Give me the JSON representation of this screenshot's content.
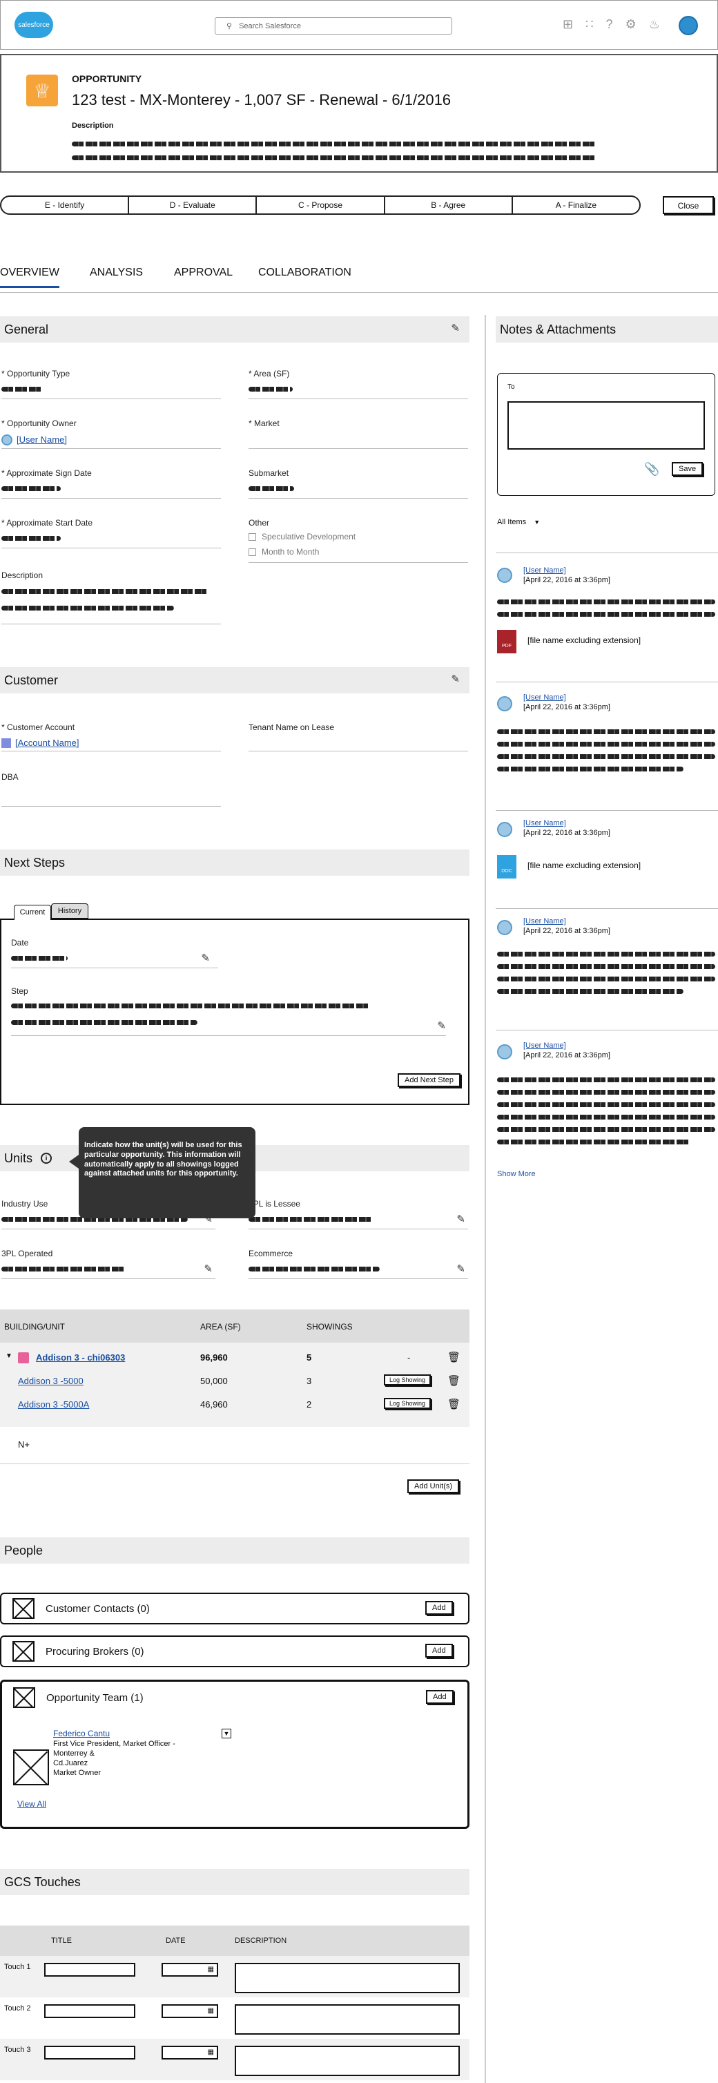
{
  "header": {
    "logo": "salesforce",
    "search_placeholder": "Search Salesforce"
  },
  "record": {
    "type": "OPPORTUNITY",
    "title": "123 test - MX-Monterey - 1,007 SF - Renewal - 6/1/2016",
    "desc_label": "Description"
  },
  "path": {
    "stages": [
      "E - Identify",
      "D - Evaluate",
      "C - Propose",
      "B - Agree",
      "A - Finalize"
    ],
    "close": "Close"
  },
  "tabs": [
    "OVERVIEW",
    "ANALYSIS",
    "APPROVAL",
    "COLLABORATION"
  ],
  "general": {
    "title": "General",
    "opportunity_type": "* Opportunity Type",
    "area": "* Area (SF)",
    "owner": "* Opportunity Owner",
    "owner_value": "[User Name]",
    "market": "* Market",
    "sign_date": "* Approximate Sign Date",
    "submarket": "Submarket",
    "start_date": "* Approximate Start Date",
    "other": "Other",
    "spec_dev": "Speculative Development",
    "month_to_month": "Month to Month",
    "description": "Description"
  },
  "customer": {
    "title": "Customer",
    "account": "* Customer Account",
    "account_value": "[Account Name]",
    "tenant": "Tenant Name on Lease",
    "dba": "DBA"
  },
  "next_steps": {
    "title": "Next Steps",
    "tab_current": "Current",
    "tab_history": "History",
    "date": "Date",
    "step": "Step",
    "add": "Add Next Step"
  },
  "units": {
    "title": "Units",
    "tooltip": "Indicate how the unit(s) will be used for this particular opportunity. This information will automatically apply to all showings logged against attached units for this opportunity.",
    "industry_use": "Industry Use",
    "pl_lessee": "3PL is Lessee",
    "pl_operated": "3PL Operated",
    "ecommerce": "Ecommerce",
    "col_building": "BUILDING/UNIT",
    "col_area": "AREA (SF)",
    "col_showings": "SHOWINGS",
    "rows": [
      {
        "name": "Addison 3 - chi06303",
        "area": "96,960",
        "showings": "5",
        "extra": "-"
      },
      {
        "name": "Addison 3 -5000",
        "area": "50,000",
        "showings": "3",
        "extra": "Log Showing"
      },
      {
        "name": "Addison 3 -5000A",
        "area": "46,960",
        "showings": "2",
        "extra": "Log Showing"
      }
    ],
    "na": "N+",
    "add_units": "Add Unit(s)"
  },
  "people": {
    "title": "People",
    "customer_contacts": "Customer Contacts (0)",
    "procuring_brokers": "Procuring Brokers (0)",
    "team": "Opportunity Team (1)",
    "add": "Add",
    "member_name": "Federico Cantu",
    "member_line1": "First Vice President, Market Officer -",
    "member_line2": "Monterrey &",
    "member_line3": "Cd.Juarez",
    "member_line4": "Market Owner",
    "view_all": "View All"
  },
  "gcs": {
    "title": "GCS Touches",
    "col_title": "TITLE",
    "col_date": "DATE",
    "col_description": "DESCRIPTION",
    "touches": [
      "Touch 1",
      "Touch 2",
      "Touch 3"
    ]
  },
  "notes": {
    "title": "Notes & Attachments",
    "to": "To",
    "save": "Save",
    "filter": "All Items",
    "user": "[User Name]",
    "date": "[April 22, 2016 at 3:36pm]",
    "file": "[file name excluding extension]",
    "pdf": "PDF",
    "doc": "DOC",
    "show_more": "Show More"
  }
}
